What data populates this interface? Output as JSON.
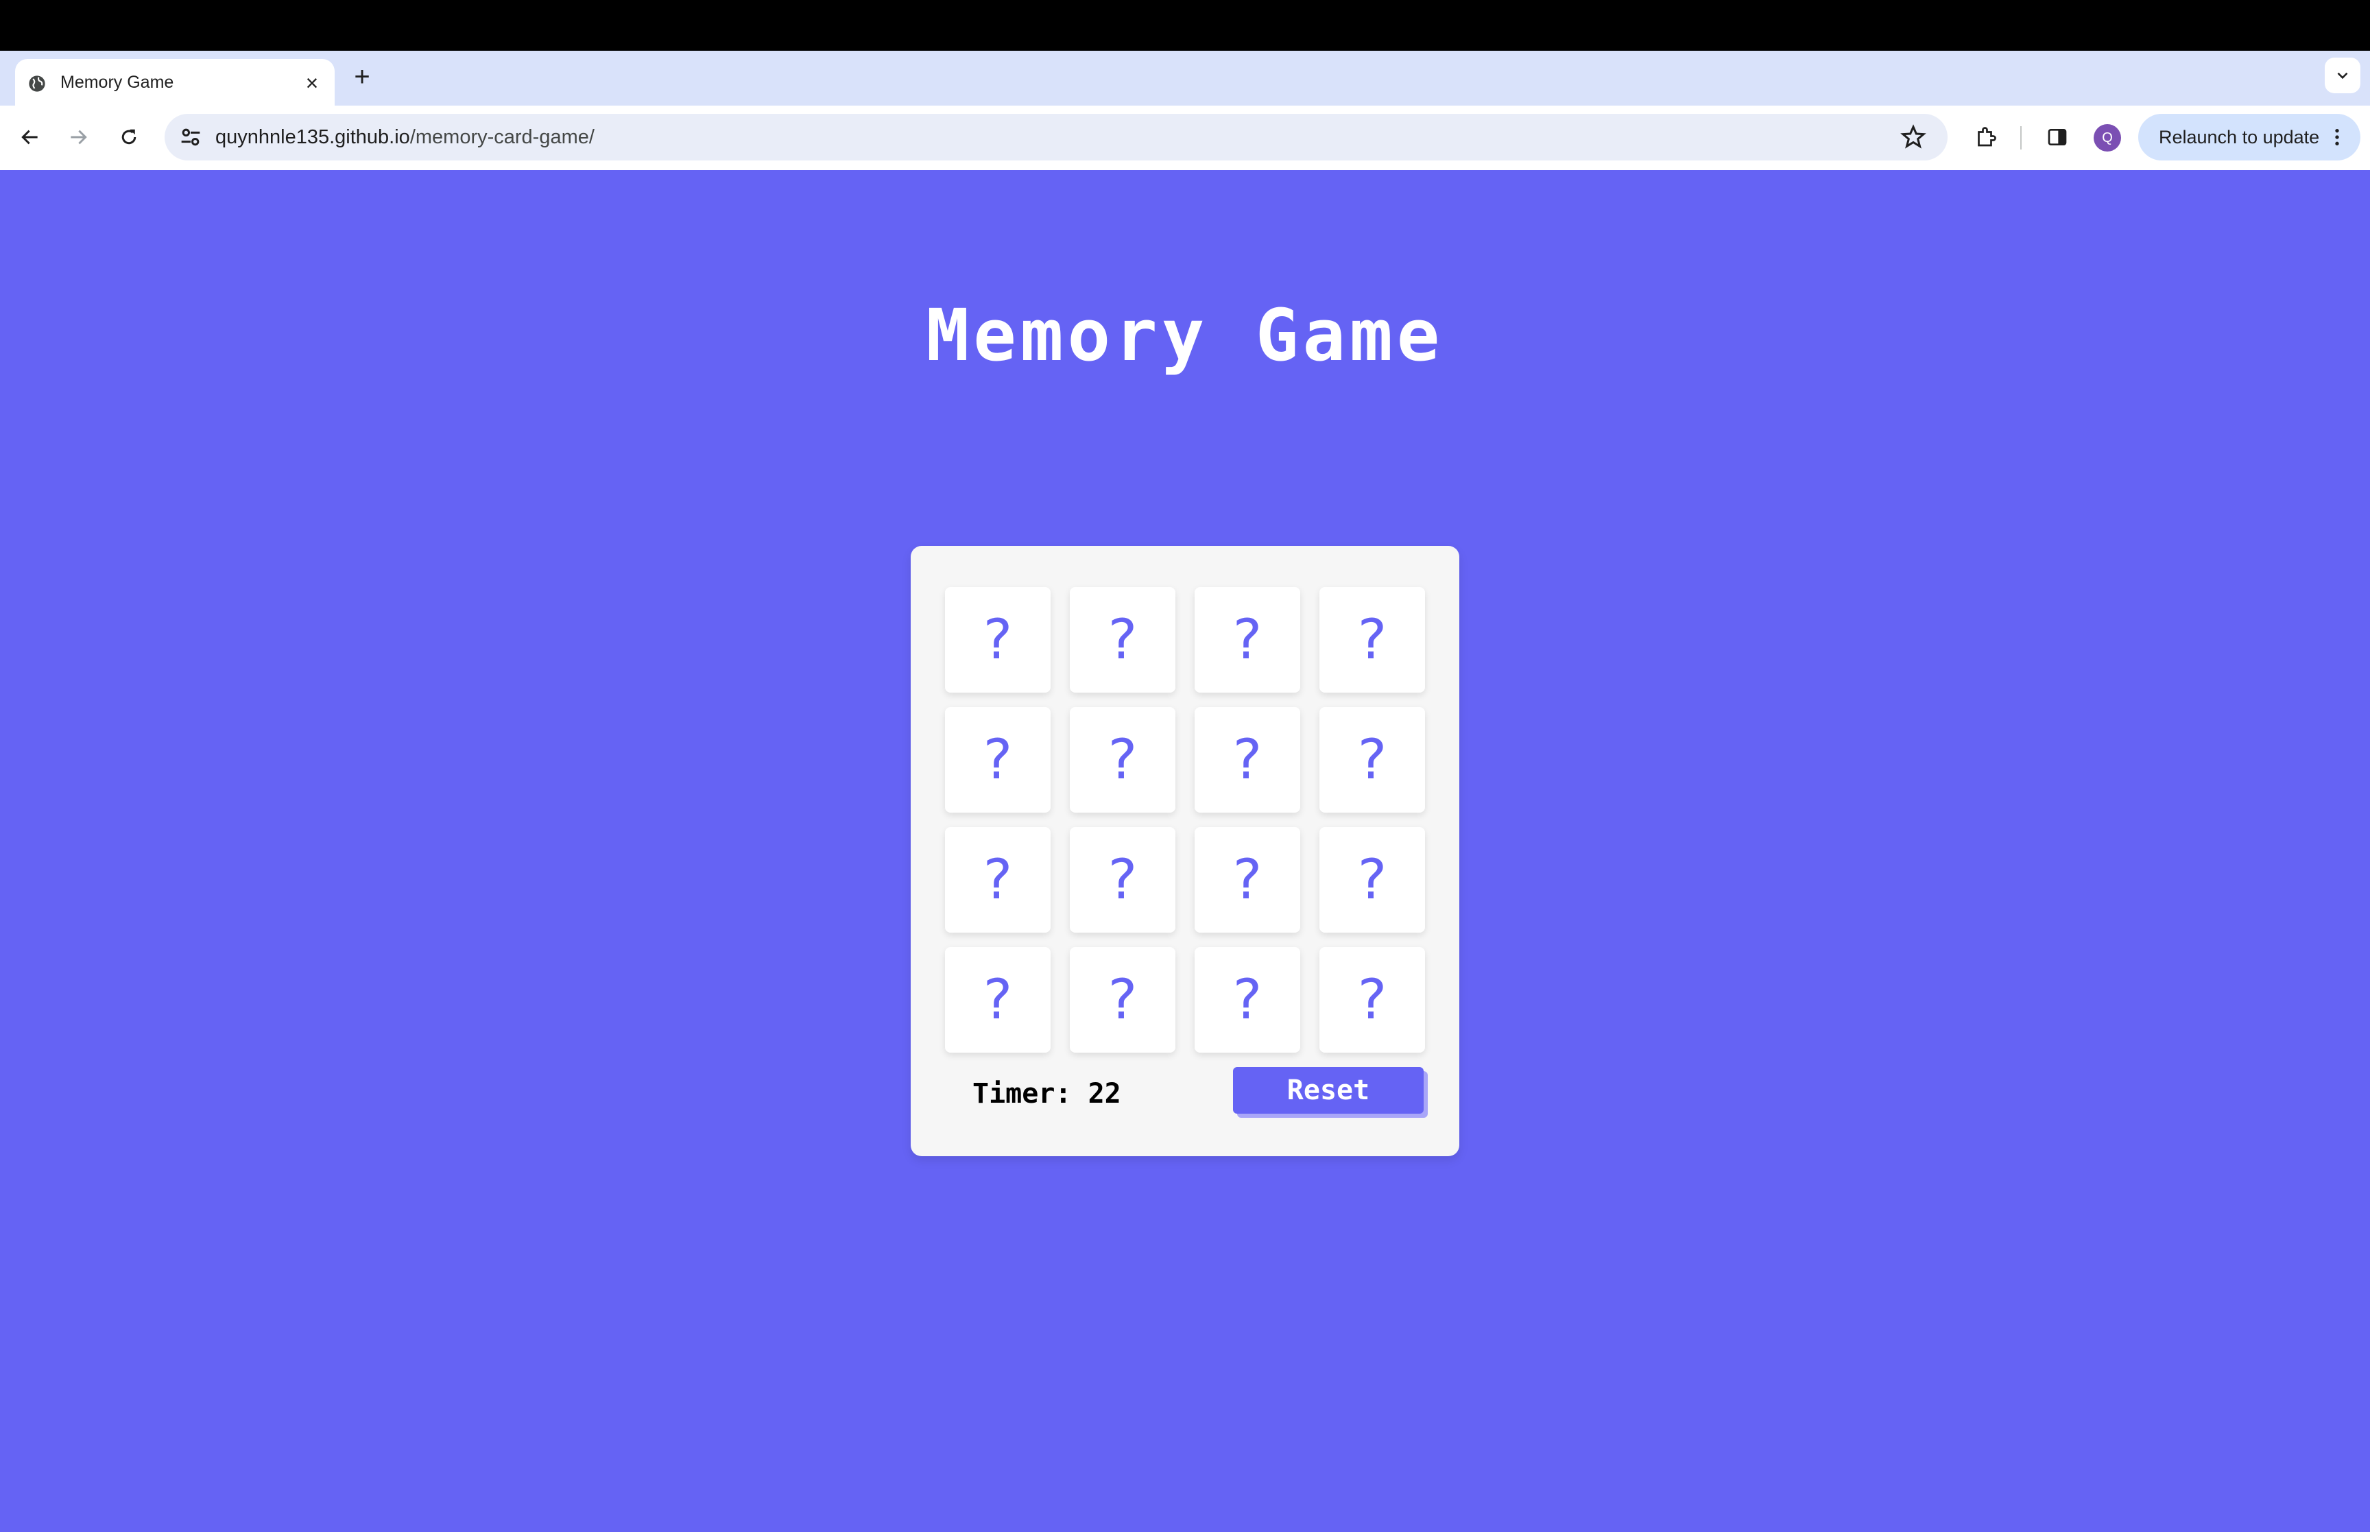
{
  "browser": {
    "tab": {
      "title": "Memory Game",
      "favicon": "globe-icon",
      "close_icon": "close-icon"
    },
    "new_tab_icon": "plus-icon",
    "tab_search_icon": "chevron-down-icon",
    "nav": {
      "back": "back-arrow-icon",
      "forward": "forward-arrow-icon",
      "reload": "reload-icon"
    },
    "address": {
      "host": "quynhnle135.github.io",
      "path": "/memory-card-game/"
    },
    "profile_initial": "Q",
    "relaunch_label": "Relaunch to update",
    "colors": {
      "tab_strip": "#d9e2fa",
      "omnibox": "#e9edf8",
      "relaunch": "#d3e3fd",
      "avatar": "#7b4fb3"
    }
  },
  "game": {
    "title": "Memory Game",
    "cards": [
      "?",
      "?",
      "?",
      "?",
      "?",
      "?",
      "?",
      "?",
      "?",
      "?",
      "?",
      "?",
      "?",
      "?",
      "?",
      "?"
    ],
    "timer_label": "Timer:",
    "timer_value": "22",
    "reset_label": "Reset",
    "colors": {
      "background": "#6563f4",
      "board": "#f6f6f6",
      "card": "#ffffff",
      "accent": "#6563f4"
    }
  }
}
